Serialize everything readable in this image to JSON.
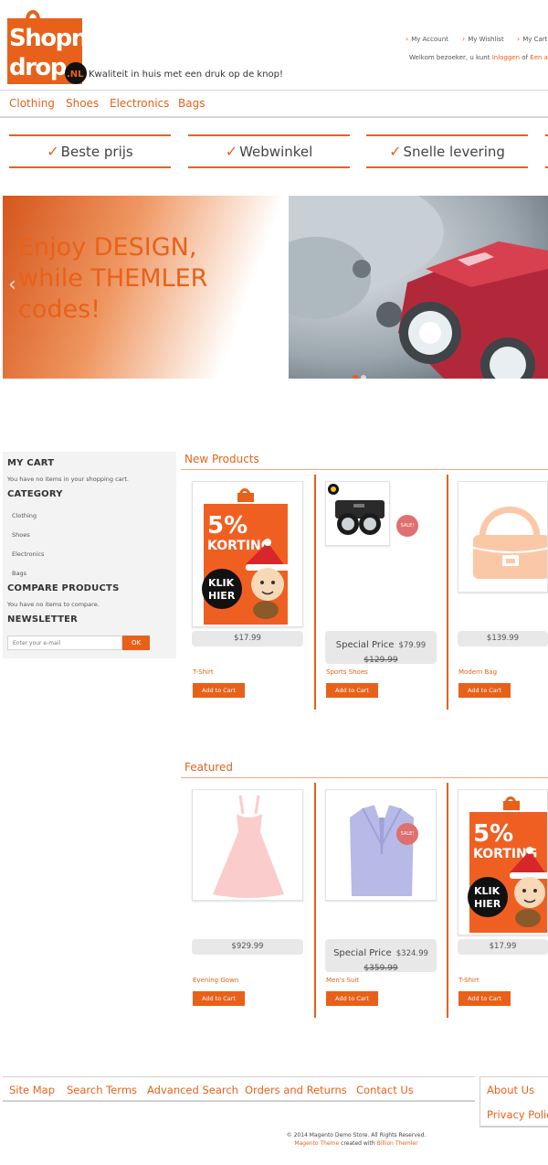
{
  "header": {
    "logo_text": "Shopn drop .NL",
    "tagline": "Kwaliteit in huis met een druk op de knop!",
    "links": [
      "My Account",
      "My Wishlist",
      "My Cart"
    ],
    "welcome_text": "Welkom bezoeker, u kunt",
    "login_link": "Inloggen",
    "or_text": "of",
    "register_link": "Een accou"
  },
  "nav": {
    "items": [
      "Clothing",
      "Shoes",
      "Electronics",
      "Bags"
    ]
  },
  "usp": [
    "Beste prijs",
    "Webwinkel",
    "Snelle levering"
  ],
  "slider": {
    "line1": "Enjoy DESIGN,",
    "line2": "while THEMLER",
    "line3": "codes!",
    "prev": "‹"
  },
  "sidebar": {
    "cart_title": "MY CART",
    "cart_text": "You have no items in your shopping cart.",
    "category_title": "CATEGORY",
    "categories": [
      "Clothing",
      "Shoes",
      "Electronics",
      "Bags"
    ],
    "compare_title": "COMPARE PRODUCTS",
    "compare_text": "You have no items to compare.",
    "newsletter_title": "NEWSLETTER",
    "newsletter_placeholder": "Enter your e-mail",
    "newsletter_button": "OK"
  },
  "new_products": {
    "title": "New Products",
    "items": [
      {
        "name": "T-Shirt",
        "price": "$17.99",
        "button": "Add to Cart",
        "promo_1": "5%",
        "promo_2": "KORTING",
        "promo_3": "KLIK",
        "promo_4": "HIER"
      },
      {
        "name": "Sports Shoes",
        "special_label": "Special Price",
        "price": "$79.99",
        "old_price": "$129.99",
        "sale": "SALE!",
        "button": "Add to Cart"
      },
      {
        "name": "Modern Bag",
        "price": "$139.99",
        "button": "Add to Cart"
      }
    ]
  },
  "featured": {
    "title": "Featured",
    "items": [
      {
        "name": "Evening Gown",
        "price": "$929.99",
        "button": "Add to Cart"
      },
      {
        "name": "Men's Suit",
        "special_label": "Special Price",
        "price": "$324.99",
        "old_price": "$359.99",
        "sale": "SALE!",
        "button": "Add to Cart"
      },
      {
        "name": "T-Shirt",
        "price": "$17.99",
        "button": "Add to Cart",
        "promo_1": "5%",
        "promo_2": "KORTING",
        "promo_3": "KLIK",
        "promo_4": "HIER"
      }
    ]
  },
  "footer": {
    "links": [
      "Site Map",
      "Search Terms",
      "Advanced Search",
      "Orders and Returns",
      "Contact Us"
    ],
    "right_links": [
      "About Us",
      "Privacy Polic"
    ],
    "copyright": "© 2014 Magento Demo Store. All Rights Reserved.",
    "credit_theme": "Magento Theme",
    "credit_mid": "created with",
    "credit_by": "Billion Themler"
  },
  "colors": {
    "accent": "#e8611a",
    "sale": "#e06f6f",
    "sidebar_bg": "#f3f3f3"
  }
}
